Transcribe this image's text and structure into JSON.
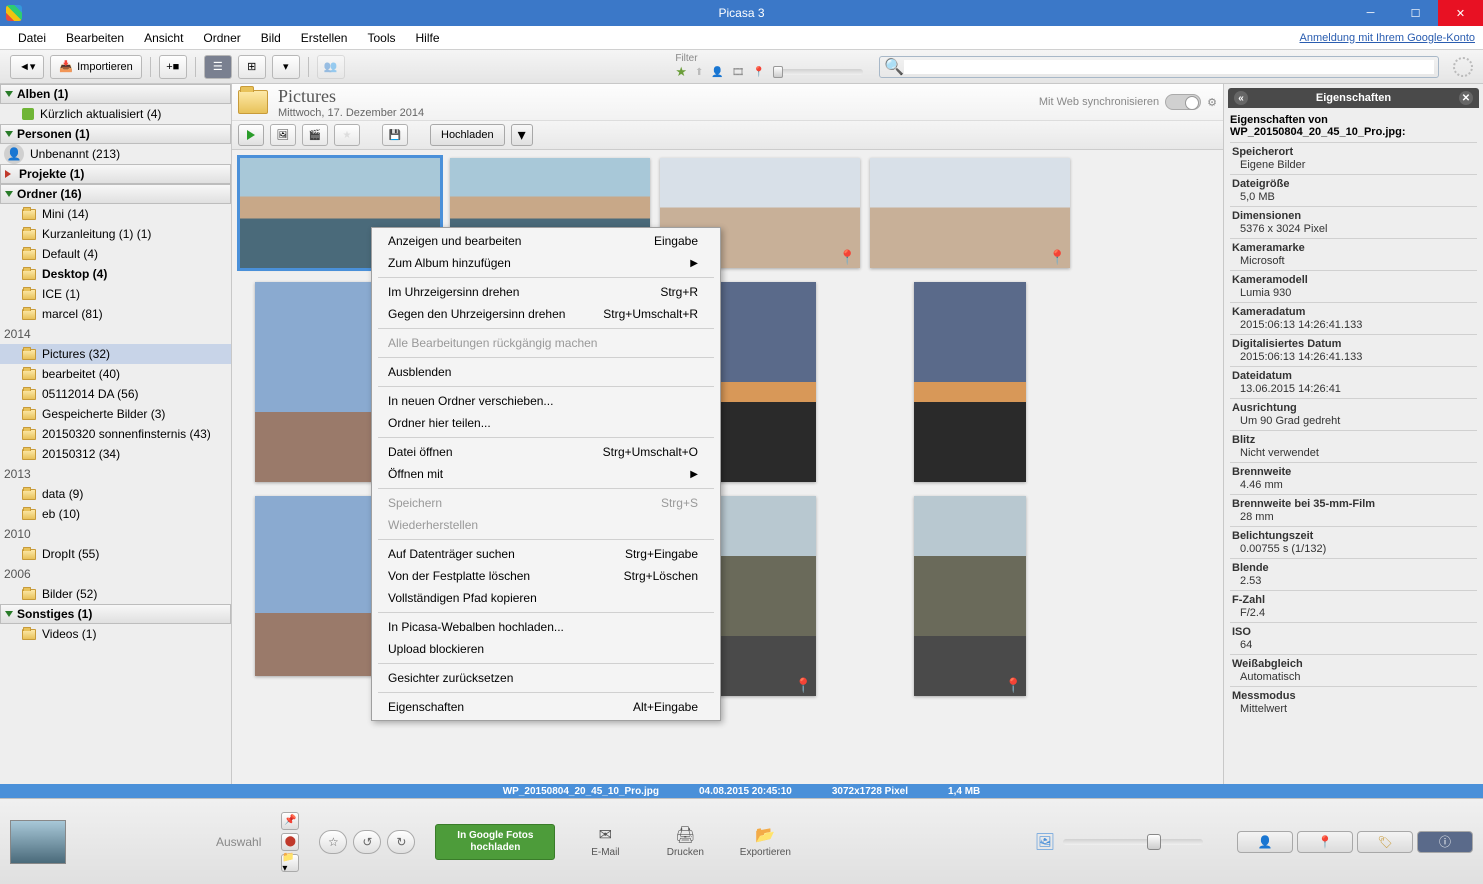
{
  "titlebar": {
    "title": "Picasa 3"
  },
  "menubar": {
    "items": [
      "Datei",
      "Bearbeiten",
      "Ansicht",
      "Ordner",
      "Bild",
      "Erstellen",
      "Tools",
      "Hilfe"
    ],
    "google_link": "Anmeldung mit Ihrem Google-Konto"
  },
  "toolbar": {
    "import_label": "Importieren",
    "filter_label": "Filter"
  },
  "sidebar": {
    "sections": [
      {
        "label": "Alben (1)",
        "kind": "header"
      },
      {
        "label": "Kürzlich aktualisiert (4)",
        "kind": "recent"
      },
      {
        "label": "Personen (1)",
        "kind": "header"
      },
      {
        "label": "Unbenannt (213)",
        "kind": "person"
      },
      {
        "label": "Projekte (1)",
        "kind": "header-red"
      },
      {
        "label": "Ordner (16)",
        "kind": "header"
      },
      {
        "label": "Mini (14)",
        "kind": "folder"
      },
      {
        "label": "Kurzanleitung (1) (1)",
        "kind": "folder"
      },
      {
        "label": "Default (4)",
        "kind": "folder"
      },
      {
        "label": "Desktop (4)",
        "kind": "folder",
        "bold": true
      },
      {
        "label": "ICE (1)",
        "kind": "folder"
      },
      {
        "label": "marcel (81)",
        "kind": "folder"
      },
      {
        "label": "2014",
        "kind": "year"
      },
      {
        "label": "Pictures (32)",
        "kind": "folder",
        "selected": true
      },
      {
        "label": "bearbeitet (40)",
        "kind": "folder"
      },
      {
        "label": "05112014 DA (56)",
        "kind": "folder"
      },
      {
        "label": "Gespeicherte Bilder (3)",
        "kind": "folder"
      },
      {
        "label": "20150320 sonnenfinsternis (43)",
        "kind": "folder"
      },
      {
        "label": "20150312 (34)",
        "kind": "folder"
      },
      {
        "label": "2013",
        "kind": "year"
      },
      {
        "label": "data (9)",
        "kind": "folder"
      },
      {
        "label": "eb (10)",
        "kind": "folder"
      },
      {
        "label": "2010",
        "kind": "year"
      },
      {
        "label": "DropIt (55)",
        "kind": "folder"
      },
      {
        "label": "2006",
        "kind": "year"
      },
      {
        "label": "Bilder (52)",
        "kind": "folder"
      },
      {
        "label": "Sonstiges (1)",
        "kind": "header"
      },
      {
        "label": "Videos (1)",
        "kind": "folder"
      }
    ]
  },
  "folder_header": {
    "title": "Pictures",
    "date": "Mittwoch, 17. Dezember 2014",
    "web_sync": "Mit Web synchronisieren"
  },
  "action_bar": {
    "upload": "Hochladen"
  },
  "context_menu": {
    "items": [
      {
        "label": "Anzeigen und bearbeiten",
        "shortcut": "Eingabe"
      },
      {
        "label": "Zum Album hinzufügen",
        "submenu": true
      },
      {
        "sep": true
      },
      {
        "label": "Im Uhrzeigersinn drehen",
        "shortcut": "Strg+R"
      },
      {
        "label": "Gegen den Uhrzeigersinn drehen",
        "shortcut": "Strg+Umschalt+R"
      },
      {
        "sep": true
      },
      {
        "label": "Alle Bearbeitungen rückgängig machen",
        "disabled": true
      },
      {
        "sep": true
      },
      {
        "label": "Ausblenden"
      },
      {
        "sep": true
      },
      {
        "label": "In neuen Ordner verschieben..."
      },
      {
        "label": "Ordner hier teilen..."
      },
      {
        "sep": true
      },
      {
        "label": "Datei öffnen",
        "shortcut": "Strg+Umschalt+O"
      },
      {
        "label": "Öffnen mit",
        "submenu": true
      },
      {
        "sep": true
      },
      {
        "label": "Speichern",
        "shortcut": "Strg+S",
        "disabled": true
      },
      {
        "label": "Wiederherstellen",
        "disabled": true
      },
      {
        "sep": true
      },
      {
        "label": "Auf Datenträger suchen",
        "shortcut": "Strg+Eingabe"
      },
      {
        "label": "Von der Festplatte löschen",
        "shortcut": "Strg+Löschen"
      },
      {
        "label": "Vollständigen Pfad kopieren"
      },
      {
        "sep": true
      },
      {
        "label": "In Picasa-Webalben hochladen..."
      },
      {
        "label": "Upload blockieren"
      },
      {
        "sep": true
      },
      {
        "label": "Gesichter zurücksetzen"
      },
      {
        "sep": true
      },
      {
        "label": "Eigenschaften",
        "shortcut": "Alt+Eingabe"
      }
    ]
  },
  "panel": {
    "title": "Eigenschaften",
    "subtitle_prefix": "Eigenschaften von",
    "filename": "WP_20150804_20_45_10_Pro.jpg:",
    "props": [
      {
        "label": "Speicherort",
        "value": "Eigene Bilder"
      },
      {
        "label": "Dateigröße",
        "value": "5,0 MB"
      },
      {
        "label": "Dimensionen",
        "value": "5376 x 3024 Pixel"
      },
      {
        "label": "Kameramarke",
        "value": "Microsoft"
      },
      {
        "label": "Kameramodell",
        "value": "Lumia 930"
      },
      {
        "label": "Kameradatum",
        "value": "2015:06:13 14:26:41.133"
      },
      {
        "label": "Digitalisiertes Datum",
        "value": "2015:06:13 14:26:41.133"
      },
      {
        "label": "Dateidatum",
        "value": "13.06.2015 14:26:41"
      },
      {
        "label": "Ausrichtung",
        "value": "Um 90 Grad gedreht"
      },
      {
        "label": "Blitz",
        "value": "Nicht verwendet"
      },
      {
        "label": "Brennweite",
        "value": "4.46 mm"
      },
      {
        "label": "Brennweite bei 35-mm-Film",
        "value": "28 mm"
      },
      {
        "label": "Belichtungszeit",
        "value": "0.00755 s (1/132)"
      },
      {
        "label": "Blende",
        "value": "2.53"
      },
      {
        "label": "F-Zahl",
        "value": "F/2.4"
      },
      {
        "label": "ISO",
        "value": "64"
      },
      {
        "label": "Weißabgleich",
        "value": "Automatisch"
      },
      {
        "label": "Messmodus",
        "value": "Mittelwert"
      }
    ]
  },
  "status": {
    "filename": "WP_20150804_20_45_10_Pro.jpg",
    "datetime": "04.08.2015 20:45:10",
    "dimensions": "3072x1728 Pixel",
    "size": "1,4 MB"
  },
  "bottom": {
    "selection": "Auswahl",
    "google_photos": "In Google Fotos hochladen",
    "email": "E-Mail",
    "print": "Drucken",
    "export": "Exportieren"
  }
}
